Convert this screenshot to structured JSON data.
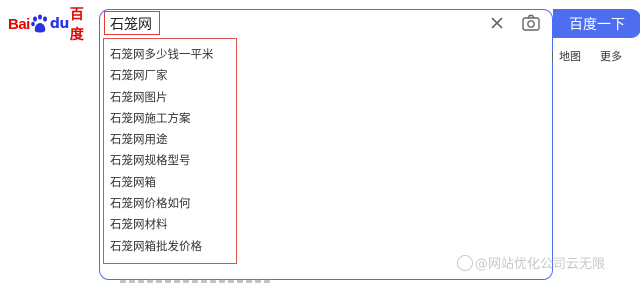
{
  "logo": {
    "text_bai": "Bai",
    "text_du": "du",
    "text_cn": "百度"
  },
  "search": {
    "value": "石笼网",
    "button_label": "百度一下"
  },
  "nav": {
    "map": "地图",
    "more": "更多"
  },
  "suggestions": [
    "石笼网多少钱一平米",
    "石笼网厂家",
    "石笼网图片",
    "石笼网施工方案",
    "石笼网用途",
    "石笼网规格型号",
    "石笼网箱",
    "石笼网价格如何",
    "石笼网材料",
    "石笼网箱批发价格"
  ],
  "watermark": "@网站优化公司云无限",
  "colors": {
    "brand_red": "#e10601",
    "brand_blue": "#4e6ef2",
    "highlight_red": "#e43a3a"
  }
}
